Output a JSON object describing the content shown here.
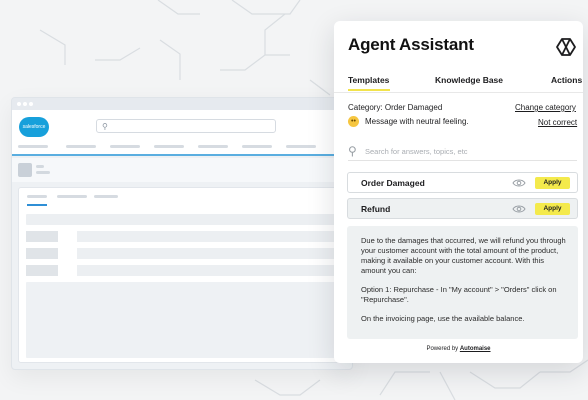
{
  "background": {
    "color": "#f3f4f5",
    "line_color": "#d9dde1"
  },
  "crm": {
    "logo_text": "salesforce",
    "accent": "#17a0db"
  },
  "assistant": {
    "title": "Agent Assistant",
    "logo_icon": "automaise-logo-icon",
    "tabs": [
      {
        "label": "Templates",
        "active": true
      },
      {
        "label": "Knowledge Base",
        "active": false
      },
      {
        "label": "Actions",
        "active": false
      }
    ],
    "category_text": "Category: Order Damaged",
    "change_category_link": "Change category",
    "sentiment_icon": "neutral-face-icon",
    "sentiment_text": "Message with neutral feeling.",
    "not_correct_link": "Not correct",
    "search_placeholder": "Search for answers, topics, etc",
    "templates": [
      {
        "label": "Order Damaged",
        "apply_label": "Apply",
        "expanded": false
      },
      {
        "label": "Refund",
        "apply_label": "Apply",
        "expanded": true
      }
    ],
    "expanded_body": [
      "Due to the damages that occurred, we will refund you through your customer account with the total amount of the product, making it available on your customer account. With this amount you can:",
      "Option 1: Repurchase - In \"My account\" > \"Orders\" click on \"Repurchase\".",
      "On the invoicing page, use the available balance."
    ],
    "footer_prefix": "Powered by",
    "footer_brand": "Automaise",
    "accent_color": "#f4ea4c"
  }
}
